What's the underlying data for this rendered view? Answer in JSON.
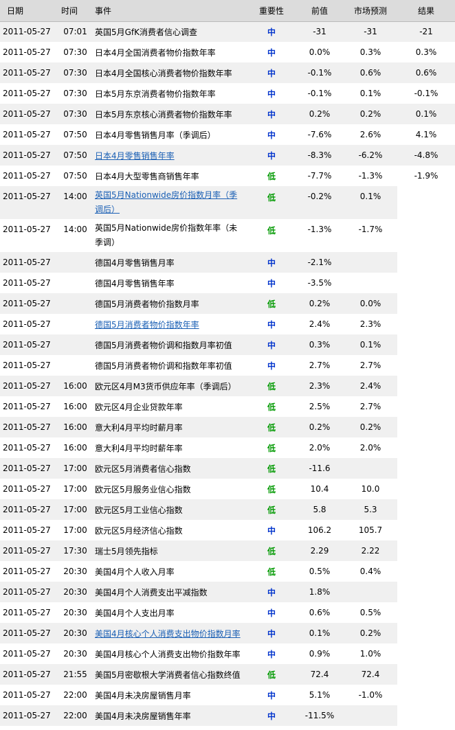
{
  "headers": {
    "date": "日期",
    "time": "时间",
    "event": "事件",
    "importance": "重要性",
    "previous": "前值",
    "forecast": "市场预测",
    "result": "结果"
  },
  "colors": {
    "header_bg": "#dcdcdc",
    "row_alt_bg": "#f0f0f0",
    "importance_mid": "#0033cc",
    "importance_low": "#009900",
    "link": "#1a5fb4"
  },
  "rows": [
    {
      "date": "2011-05-27",
      "time": "07:01",
      "event": "英国5月GfK消费者信心调查",
      "importance": "中",
      "level": "high",
      "previous": "-31",
      "forecast": "-31",
      "result": "-21",
      "link": false
    },
    {
      "date": "2011-05-27",
      "time": "07:30",
      "event": "日本4月全国消费者物价指数年率",
      "importance": "中",
      "level": "high",
      "previous": "0.0%",
      "forecast": "0.3%",
      "result": "0.3%",
      "link": false
    },
    {
      "date": "2011-05-27",
      "time": "07:30",
      "event": "日本4月全国核心消费者物价指数年率",
      "importance": "中",
      "level": "high",
      "previous": "-0.1%",
      "forecast": "0.6%",
      "result": "0.6%",
      "link": false
    },
    {
      "date": "2011-05-27",
      "time": "07:30",
      "event": "日本5月东京消费者物价指数年率",
      "importance": "中",
      "level": "high",
      "previous": "-0.1%",
      "forecast": "0.1%",
      "result": "-0.1%",
      "link": false
    },
    {
      "date": "2011-05-27",
      "time": "07:30",
      "event": "日本5月东京核心消费者物价指数年率",
      "importance": "中",
      "level": "high",
      "previous": "0.2%",
      "forecast": "0.2%",
      "result": "0.1%",
      "link": false
    },
    {
      "date": "2011-05-27",
      "time": "07:50",
      "event": "日本4月零售销售月率（季调后）",
      "importance": "中",
      "level": "high",
      "previous": "-7.6%",
      "forecast": "2.6%",
      "result": "4.1%",
      "link": false
    },
    {
      "date": "2011-05-27",
      "time": "07:50",
      "event": "日本4月零售销售年率",
      "importance": "中",
      "level": "high",
      "previous": "-8.3%",
      "forecast": "-6.2%",
      "result": "-4.8%",
      "link": true
    },
    {
      "date": "2011-05-27",
      "time": "07:50",
      "event": "日本4月大型零售商销售年率",
      "importance": "低",
      "level": "low",
      "previous": "-7.7%",
      "forecast": "-1.3%",
      "result": "-1.9%",
      "link": false
    },
    {
      "date": "2011-05-27",
      "time": "14:00",
      "event": "英国5月Nationwide房价指数月率（季调后）",
      "importance": "低",
      "level": "low",
      "previous": "-0.2%",
      "forecast": "0.1%",
      "result": "",
      "link": true,
      "tall": true
    },
    {
      "date": "2011-05-27",
      "time": "14:00",
      "event": "英国5月Nationwide房价指数年率（未季调）",
      "importance": "低",
      "level": "low",
      "previous": "-1.3%",
      "forecast": "-1.7%",
      "result": "",
      "link": false,
      "tall": true
    },
    {
      "date": "2011-05-27",
      "time": "",
      "event": "德国4月零售销售月率",
      "importance": "中",
      "level": "high",
      "previous": "-2.1%",
      "forecast": "",
      "result": "",
      "link": false
    },
    {
      "date": "2011-05-27",
      "time": "",
      "event": "德国4月零售销售年率",
      "importance": "中",
      "level": "high",
      "previous": "-3.5%",
      "forecast": "",
      "result": "",
      "link": false
    },
    {
      "date": "2011-05-27",
      "time": "",
      "event": "德国5月消费者物价指数月率",
      "importance": "低",
      "level": "low",
      "previous": "0.2%",
      "forecast": "0.0%",
      "result": "",
      "link": false
    },
    {
      "date": "2011-05-27",
      "time": "",
      "event": "德国5月消费者物价指数年率",
      "importance": "中",
      "level": "high",
      "previous": "2.4%",
      "forecast": "2.3%",
      "result": "",
      "link": true
    },
    {
      "date": "2011-05-27",
      "time": "",
      "event": "德国5月消费者物价调和指数月率初值",
      "importance": "中",
      "level": "high",
      "previous": "0.3%",
      "forecast": "0.1%",
      "result": "",
      "link": false
    },
    {
      "date": "2011-05-27",
      "time": "",
      "event": "德国5月消费者物价调和指数年率初值",
      "importance": "中",
      "level": "high",
      "previous": "2.7%",
      "forecast": "2.7%",
      "result": "",
      "link": false
    },
    {
      "date": "2011-05-27",
      "time": "16:00",
      "event": "欧元区4月M3货币供应年率（季调后）",
      "importance": "低",
      "level": "low",
      "previous": "2.3%",
      "forecast": "2.4%",
      "result": "",
      "link": false
    },
    {
      "date": "2011-05-27",
      "time": "16:00",
      "event": "欧元区4月企业贷款年率",
      "importance": "低",
      "level": "low",
      "previous": "2.5%",
      "forecast": "2.7%",
      "result": "",
      "link": false
    },
    {
      "date": "2011-05-27",
      "time": "16:00",
      "event": "意大利4月平均时薪月率",
      "importance": "低",
      "level": "low",
      "previous": "0.2%",
      "forecast": "0.2%",
      "result": "",
      "link": false
    },
    {
      "date": "2011-05-27",
      "time": "16:00",
      "event": "意大利4月平均时薪年率",
      "importance": "低",
      "level": "low",
      "previous": "2.0%",
      "forecast": "2.0%",
      "result": "",
      "link": false
    },
    {
      "date": "2011-05-27",
      "time": "17:00",
      "event": "欧元区5月消费者信心指数",
      "importance": "低",
      "level": "low",
      "previous": "-11.6",
      "forecast": "",
      "result": "",
      "link": false
    },
    {
      "date": "2011-05-27",
      "time": "17:00",
      "event": "欧元区5月服务业信心指数",
      "importance": "低",
      "level": "low",
      "previous": "10.4",
      "forecast": "10.0",
      "result": "",
      "link": false
    },
    {
      "date": "2011-05-27",
      "time": "17:00",
      "event": "欧元区5月工业信心指数",
      "importance": "低",
      "level": "low",
      "previous": "5.8",
      "forecast": "5.3",
      "result": "",
      "link": false
    },
    {
      "date": "2011-05-27",
      "time": "17:00",
      "event": "欧元区5月经济信心指数",
      "importance": "中",
      "level": "high",
      "previous": "106.2",
      "forecast": "105.7",
      "result": "",
      "link": false
    },
    {
      "date": "2011-05-27",
      "time": "17:30",
      "event": "瑞士5月领先指标",
      "importance": "低",
      "level": "low",
      "previous": "2.29",
      "forecast": "2.22",
      "result": "",
      "link": false
    },
    {
      "date": "2011-05-27",
      "time": "20:30",
      "event": "美国4月个人收入月率",
      "importance": "低",
      "level": "low",
      "previous": "0.5%",
      "forecast": "0.4%",
      "result": "",
      "link": false
    },
    {
      "date": "2011-05-27",
      "time": "20:30",
      "event": "美国4月个人消费支出平减指数",
      "importance": "中",
      "level": "high",
      "previous": "1.8%",
      "forecast": "",
      "result": "",
      "link": false
    },
    {
      "date": "2011-05-27",
      "time": "20:30",
      "event": "美国4月个人支出月率",
      "importance": "中",
      "level": "high",
      "previous": "0.6%",
      "forecast": "0.5%",
      "result": "",
      "link": false
    },
    {
      "date": "2011-05-27",
      "time": "20:30",
      "event": "美国4月核心个人消费支出物价指数月率",
      "importance": "中",
      "level": "high",
      "previous": "0.1%",
      "forecast": "0.2%",
      "result": "",
      "link": true
    },
    {
      "date": "2011-05-27",
      "time": "20:30",
      "event": "美国4月核心个人消费支出物价指数年率",
      "importance": "中",
      "level": "high",
      "previous": "0.9%",
      "forecast": "1.0%",
      "result": "",
      "link": false
    },
    {
      "date": "2011-05-27",
      "time": "21:55",
      "event": "美国5月密歇根大学消费者信心指数终值",
      "importance": "低",
      "level": "low",
      "previous": "72.4",
      "forecast": "72.4",
      "result": "",
      "link": false
    },
    {
      "date": "2011-05-27",
      "time": "22:00",
      "event": "美国4月未决房屋销售月率",
      "importance": "中",
      "level": "high",
      "previous": "5.1%",
      "forecast": "-1.0%",
      "result": "",
      "link": false
    },
    {
      "date": "2011-05-27",
      "time": "22:00",
      "event": "美国4月未决房屋销售年率",
      "importance": "中",
      "level": "high",
      "previous": "-11.5%",
      "forecast": "",
      "result": "",
      "link": false
    }
  ]
}
